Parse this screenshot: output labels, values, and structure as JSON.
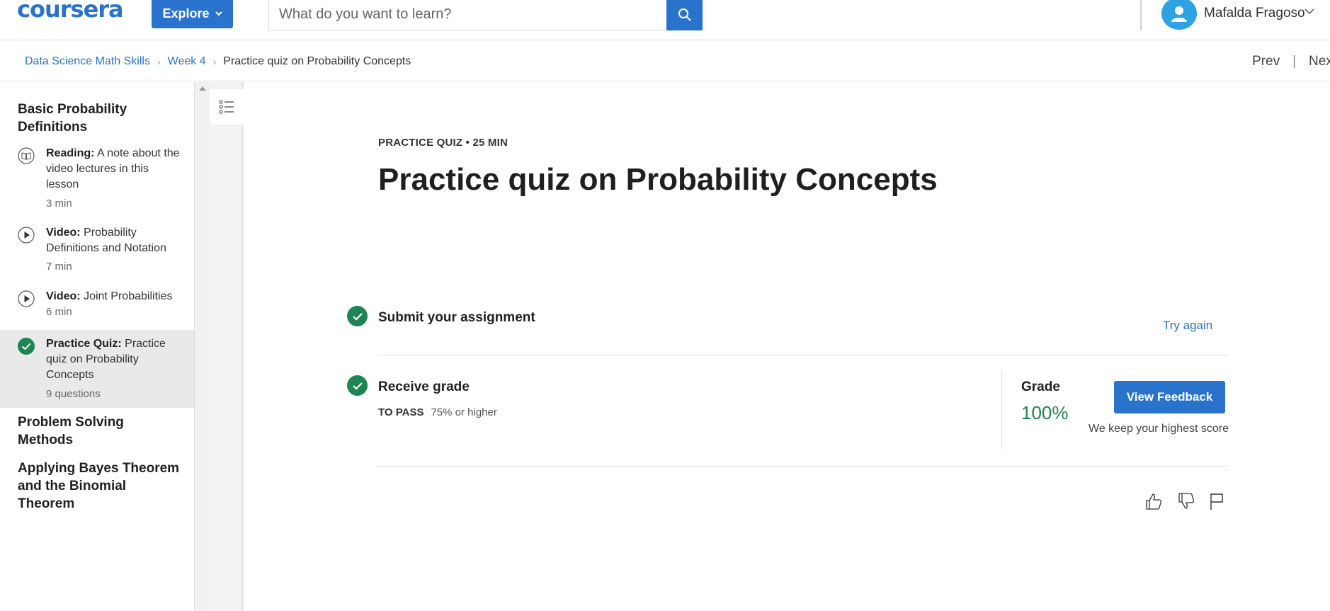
{
  "header": {
    "logo": "coursera",
    "explore_label": "Explore",
    "search_placeholder": "What do you want to learn?",
    "user_name": "Mafalda Fragoso"
  },
  "breadcrumb": {
    "items": [
      "Data Science Math Skills",
      "Week 4",
      "Practice quiz on Probability Concepts"
    ],
    "prev": "Prev",
    "separator": "|",
    "next": "Nex"
  },
  "sidebar": {
    "modules": [
      {
        "title": "Basic Probability Definitions"
      },
      {
        "title": "Problem Solving Methods"
      },
      {
        "title": "Applying Bayes Theorem and the Binomial Theorem"
      }
    ],
    "items": [
      {
        "type": "Reading:",
        "title": "A note about the video lectures in this lesson",
        "meta": "3 min",
        "icon": "book-icon"
      },
      {
        "type": "Video:",
        "title": "Probability Definitions and Notation",
        "meta": "7 min",
        "icon": "play-icon"
      },
      {
        "type": "Video:",
        "title": "Joint Probabilities",
        "meta": "6 min",
        "icon": "play-icon"
      },
      {
        "type": "Practice Quiz:",
        "title": "Practice quiz on Probability Concepts",
        "meta": "9 questions",
        "icon": "check-circle-icon"
      }
    ]
  },
  "main": {
    "kicker": "PRACTICE QUIZ • 25 MIN",
    "title": "Practice quiz on Probability Concepts",
    "submit_label": "Submit your assignment",
    "try_again": "Try again",
    "receive_label": "Receive grade",
    "to_pass_label": "TO PASS",
    "to_pass_value": "75% or higher",
    "grade_label": "Grade",
    "grade_value": "100%",
    "view_feedback": "View Feedback",
    "highest_note": "We keep your highest score"
  },
  "colors": {
    "brand_blue": "#2a73cc",
    "success_green": "#1f8354",
    "avatar_blue": "#2ea3e3"
  }
}
